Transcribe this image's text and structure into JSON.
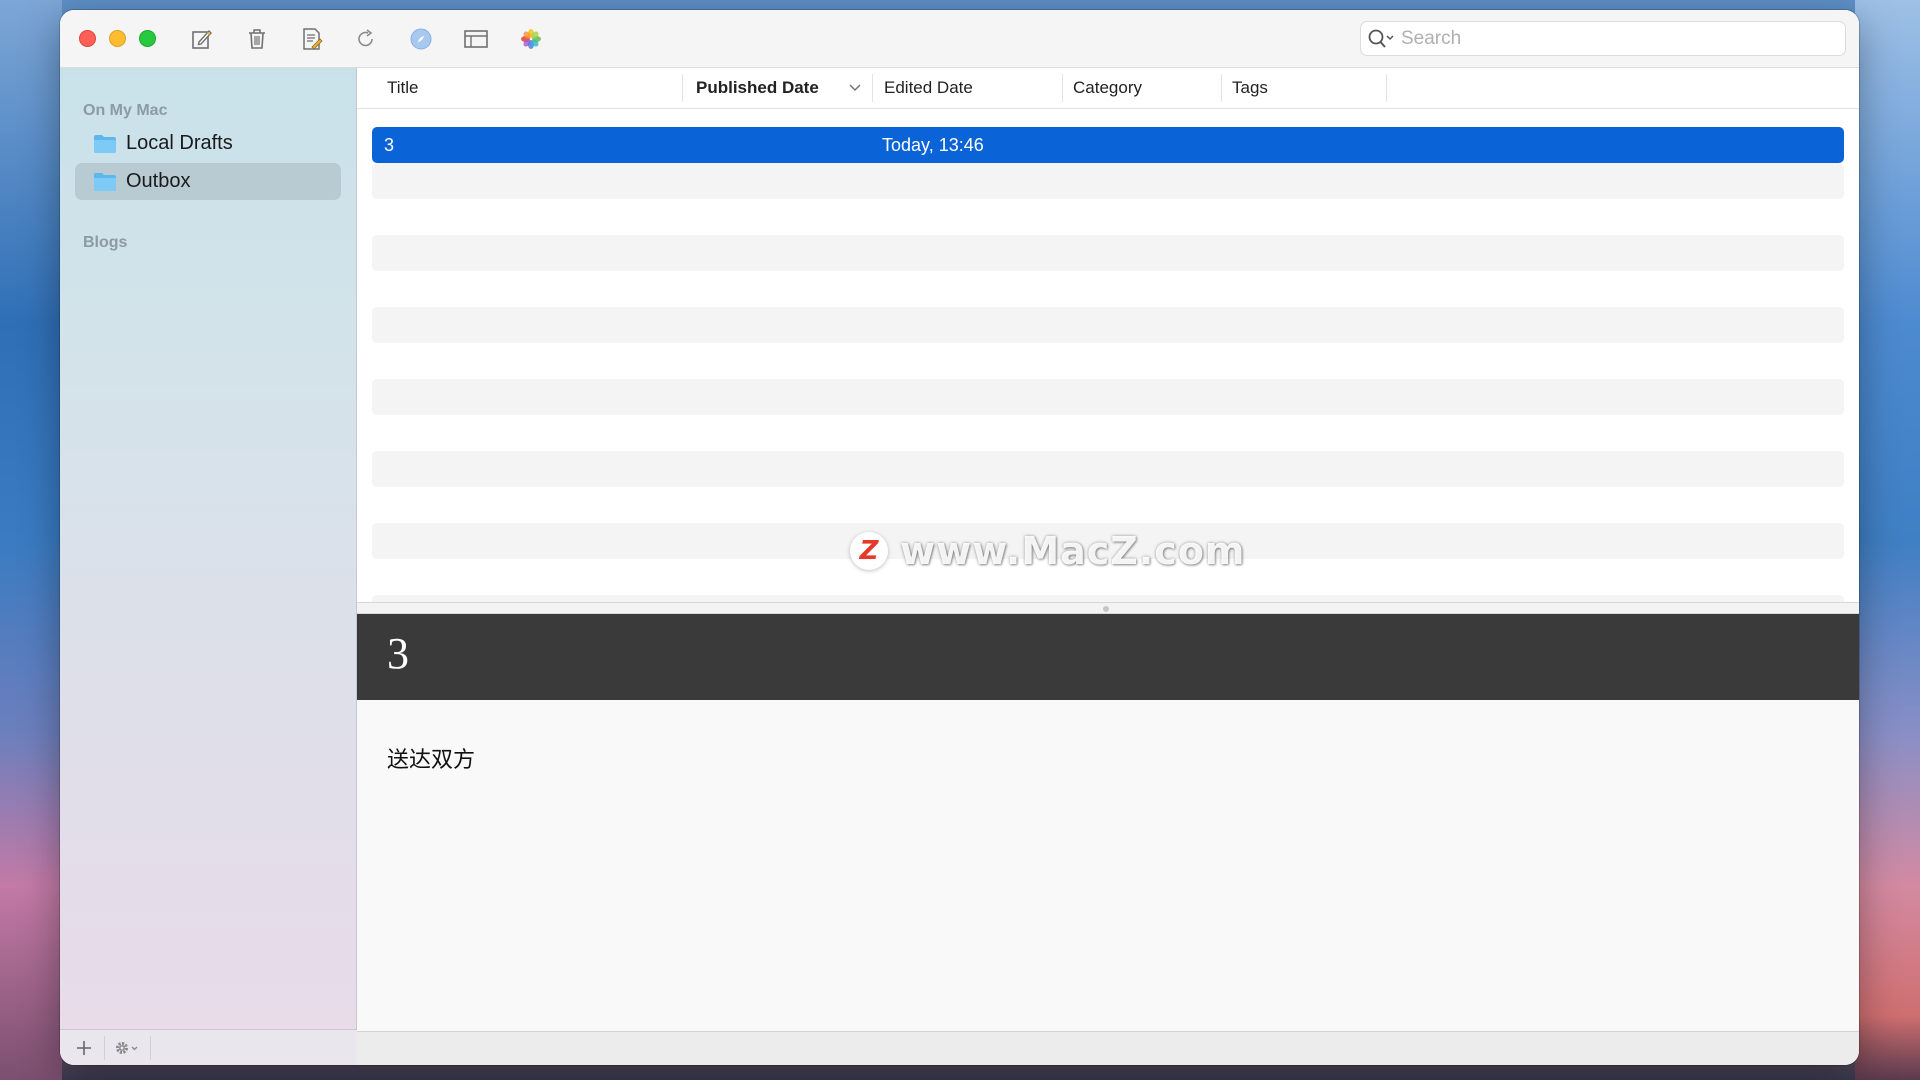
{
  "toolbar": {
    "buttons": [
      "new-post",
      "delete",
      "edit-document",
      "refresh",
      "preview-safari",
      "layout",
      "photos"
    ],
    "search_placeholder": "Search"
  },
  "sidebar": {
    "section_local": "On My Mac",
    "items": [
      {
        "label": "Local Drafts",
        "selected": false
      },
      {
        "label": "Outbox",
        "selected": true
      }
    ],
    "section_blogs": "Blogs"
  },
  "table": {
    "columns": [
      "Title",
      "Published Date",
      "Edited Date",
      "Category",
      "Tags"
    ],
    "sort_column": "Published Date",
    "rows": [
      {
        "title": "3",
        "published_date": "",
        "edited_date": "Today, 13:46",
        "category": "",
        "tags": ""
      }
    ]
  },
  "preview": {
    "title": "3",
    "body": "送达双方"
  },
  "watermark": {
    "text": "www.MacZ.com",
    "logo_letter": "Z"
  },
  "colors": {
    "selection": "#0a64d8",
    "preview_header": "#3a3a3a",
    "close": "#ff5f57",
    "minimize": "#febc2e",
    "zoom": "#28c840"
  }
}
